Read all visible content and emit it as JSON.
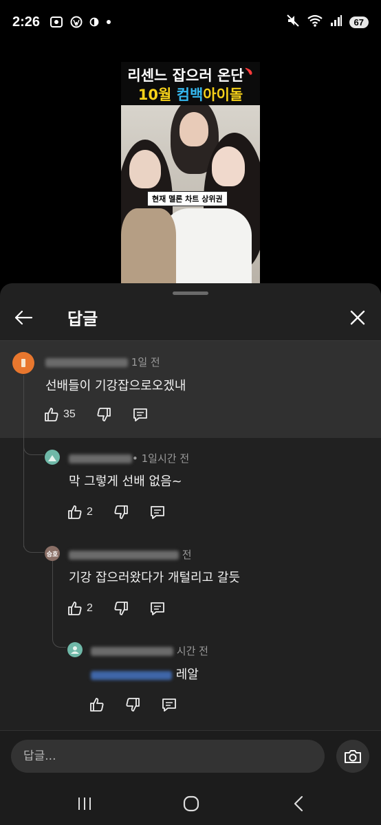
{
  "status_bar": {
    "time": "2:26",
    "battery": "67",
    "icons": [
      "screenshot-icon",
      "wordpress-icon",
      "contrast-icon",
      "dot-icon",
      "mute-icon",
      "wifi-icon",
      "signal-icon"
    ]
  },
  "video": {
    "title_line1": "리센느 잡으러 온단",
    "title_line2_a": "10월",
    "title_line2_b": "컴백",
    "title_line2_c": "아이돌",
    "caption": "현재 멜론 차트 상위권"
  },
  "sheet": {
    "title": "답글"
  },
  "comments": [
    {
      "author_suffix": "1일 전",
      "text": "선배들이 기강잡으로오겠내",
      "likes": "35",
      "avatar_color": "#e8772e"
    },
    {
      "author_suffix": "• 1일시간 전",
      "text": "막 그렇게 선배 없음~",
      "likes": "2",
      "avatar_color": "#6fb8a8"
    },
    {
      "author_suffix": "전",
      "avatar_label": "승호",
      "text": "기강 잡으러왔다가 개털리고 갈듯",
      "likes": "2",
      "avatar_color": "#8a6f66"
    },
    {
      "author_suffix": "시간 전",
      "text": "레알",
      "likes": "",
      "avatar_color": "#6fb8a8"
    }
  ],
  "reply": {
    "placeholder": "답글..."
  },
  "colors": {
    "sheet_bg": "#212121",
    "highlight_bg": "#303030",
    "title_yellow": "#f7d21a",
    "title_blue": "#35b8ef"
  }
}
